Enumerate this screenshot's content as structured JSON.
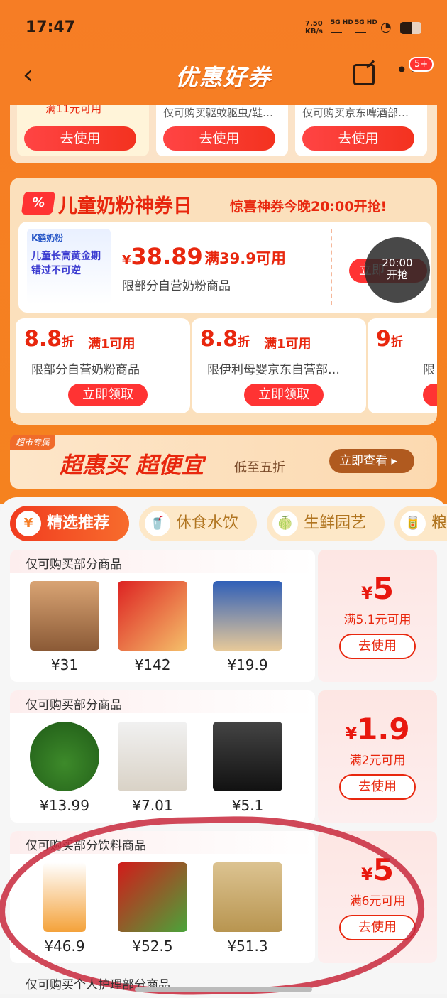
{
  "status": {
    "time": "17:47",
    "net_speed": "7.50",
    "net_unit": "KB/s",
    "sig1": "5G HD",
    "sig2": "5G HD"
  },
  "nav": {
    "title": "优惠好券",
    "badge": "5+"
  },
  "top_coupons": [
    {
      "desc": "满11元可用",
      "btn": "去使用"
    },
    {
      "desc": "仅可购买驱蚊驱虫/鞋…",
      "btn": "去使用"
    },
    {
      "desc": "仅可购买京东啤酒部…",
      "btn": "去使用"
    }
  ],
  "milk": {
    "icon": "%",
    "title": "儿童奶粉神券日",
    "hint": "惊喜神券今晚20:00开抢!",
    "product_img": {
      "brand": "K鹤奶粉",
      "slogan": "儿童长高黄金期",
      "slogan2": "错过不可逆"
    },
    "big_coupon": {
      "currency": "¥",
      "amount": "38.89",
      "cond": "满39.9可用",
      "limit": "限部分自营奶粉商品",
      "btn": "立即",
      "timer_time": "20:00",
      "timer_label": "开抢"
    },
    "small_coupons": [
      {
        "disc": "8.8",
        "unit": "折",
        "cond": "满1可用",
        "limit": "限部分自营奶粉商品",
        "btn": "立即领取"
      },
      {
        "disc": "8.8",
        "unit": "折",
        "cond": "满1可用",
        "limit": "限伊利母婴京东自营部…",
        "btn": "立即领取"
      },
      {
        "disc": "9",
        "unit": "折",
        "cond": "",
        "limit": "限",
        "btn": "立"
      }
    ]
  },
  "chaoshi": {
    "tag": "超市专属",
    "big": "超惠买 超便宜",
    "sub": "低至五折",
    "view": "立即查看"
  },
  "tabs": [
    {
      "label": "精选推荐",
      "icon": "¥"
    },
    {
      "label": "休食水饮",
      "icon": "🥤"
    },
    {
      "label": "生鲜园艺",
      "icon": "🍈"
    },
    {
      "label": "粮",
      "icon": "🥫"
    }
  ],
  "rows": [
    {
      "label": "仅可购买部分商品",
      "items": [
        {
          "price": "¥31"
        },
        {
          "price": "¥142"
        },
        {
          "price": "¥19.9"
        }
      ],
      "amount": "5",
      "cond": "满5.1元可用",
      "btn": "去使用"
    },
    {
      "label": "仅可购买部分商品",
      "items": [
        {
          "price": "¥13.99"
        },
        {
          "price": "¥7.01"
        },
        {
          "price": "¥5.1"
        }
      ],
      "amount": "1.9",
      "cond": "满2元可用",
      "btn": "去使用"
    },
    {
      "label": "仅可购买部分饮料商品",
      "items": [
        {
          "price": "¥46.9"
        },
        {
          "price": "¥52.5"
        },
        {
          "price": "¥51.3"
        }
      ],
      "amount": "5",
      "cond": "满6元可用",
      "btn": "去使用"
    }
  ],
  "last_label": "仅可购买个人护理部分商品"
}
